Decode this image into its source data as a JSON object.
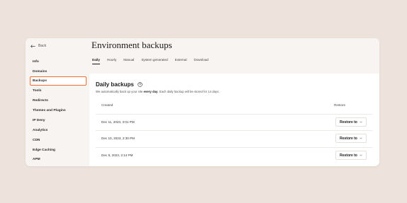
{
  "sidebar": {
    "back_label": "Back",
    "items": [
      {
        "label": "Info"
      },
      {
        "label": "Domains"
      },
      {
        "label": "Backups",
        "active": true
      },
      {
        "label": "Tools"
      },
      {
        "label": "Redirects"
      },
      {
        "label": "Themes and Plugins"
      },
      {
        "label": "IP Deny"
      },
      {
        "label": "Analytics"
      },
      {
        "label": "CDN"
      },
      {
        "label": "Edge Caching"
      },
      {
        "label": "APM"
      }
    ]
  },
  "header": {
    "title": "Environment backups",
    "tabs": [
      {
        "label": "Daily",
        "active": true
      },
      {
        "label": "Hourly"
      },
      {
        "label": "Manual"
      },
      {
        "label": "System generated"
      },
      {
        "label": "External"
      },
      {
        "label": "Download"
      }
    ]
  },
  "section": {
    "title": "Daily backups",
    "desc_before": "We automatically back up your site ",
    "desc_bold": "every day",
    "desc_after": ". Each daily backup will be stored for 14 days."
  },
  "table": {
    "col_created": "Created",
    "col_restore": "Restore",
    "rows": [
      {
        "created": "Dec 11, 2023, 3:01 PM",
        "action": "Restore to"
      },
      {
        "created": "Dec 10, 2023, 2:30 PM",
        "action": "Restore to"
      },
      {
        "created": "Dec 9, 2023, 2:14 PM",
        "action": "Restore to"
      }
    ]
  },
  "colors": {
    "background": "#ede2dc",
    "sidebar": "#f7f4f1",
    "highlight": "#f26b2f"
  }
}
